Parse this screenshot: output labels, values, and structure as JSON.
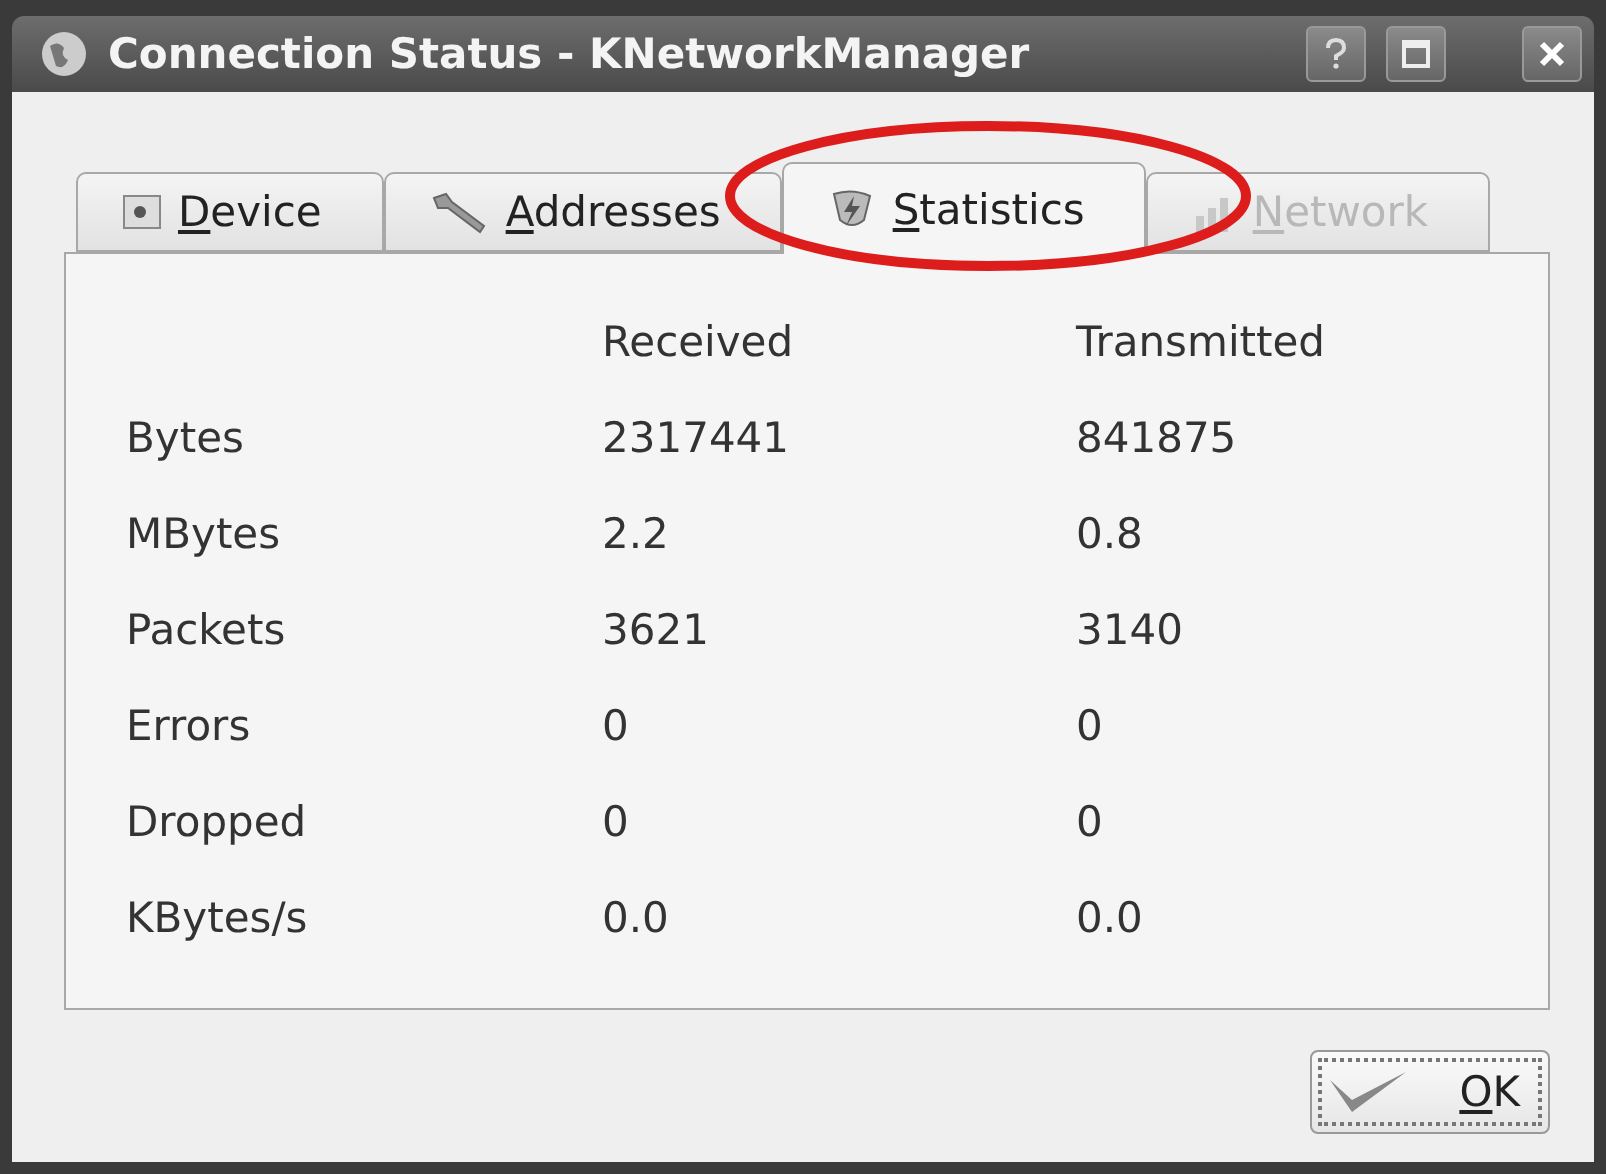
{
  "window": {
    "title": "Connection Status - KNetworkManager"
  },
  "tabs": [
    {
      "label": "Device",
      "selected": false,
      "disabled": false,
      "kind": "device"
    },
    {
      "label": "Addresses",
      "selected": false,
      "disabled": false,
      "kind": "addresses"
    },
    {
      "label": "Statistics",
      "selected": true,
      "disabled": false,
      "kind": "statistics"
    },
    {
      "label": "Network",
      "selected": false,
      "disabled": true,
      "kind": "network"
    }
  ],
  "table": {
    "columns": [
      "Received",
      "Transmitted"
    ],
    "rows": [
      {
        "label": "Bytes",
        "cells": [
          "2317441",
          "841875"
        ]
      },
      {
        "label": "MBytes",
        "cells": [
          "2.2",
          "0.8"
        ]
      },
      {
        "label": "Packets",
        "cells": [
          "3621",
          "3140"
        ]
      },
      {
        "label": "Errors",
        "cells": [
          "0",
          "0"
        ]
      },
      {
        "label": "Dropped",
        "cells": [
          "0",
          "0"
        ]
      },
      {
        "label": "KBytes/s",
        "cells": [
          "0.0",
          "0.0"
        ]
      }
    ]
  },
  "buttons": [
    {
      "label": "OK",
      "kind": "ok"
    }
  ],
  "annotation": {
    "kind": "ellipse"
  }
}
